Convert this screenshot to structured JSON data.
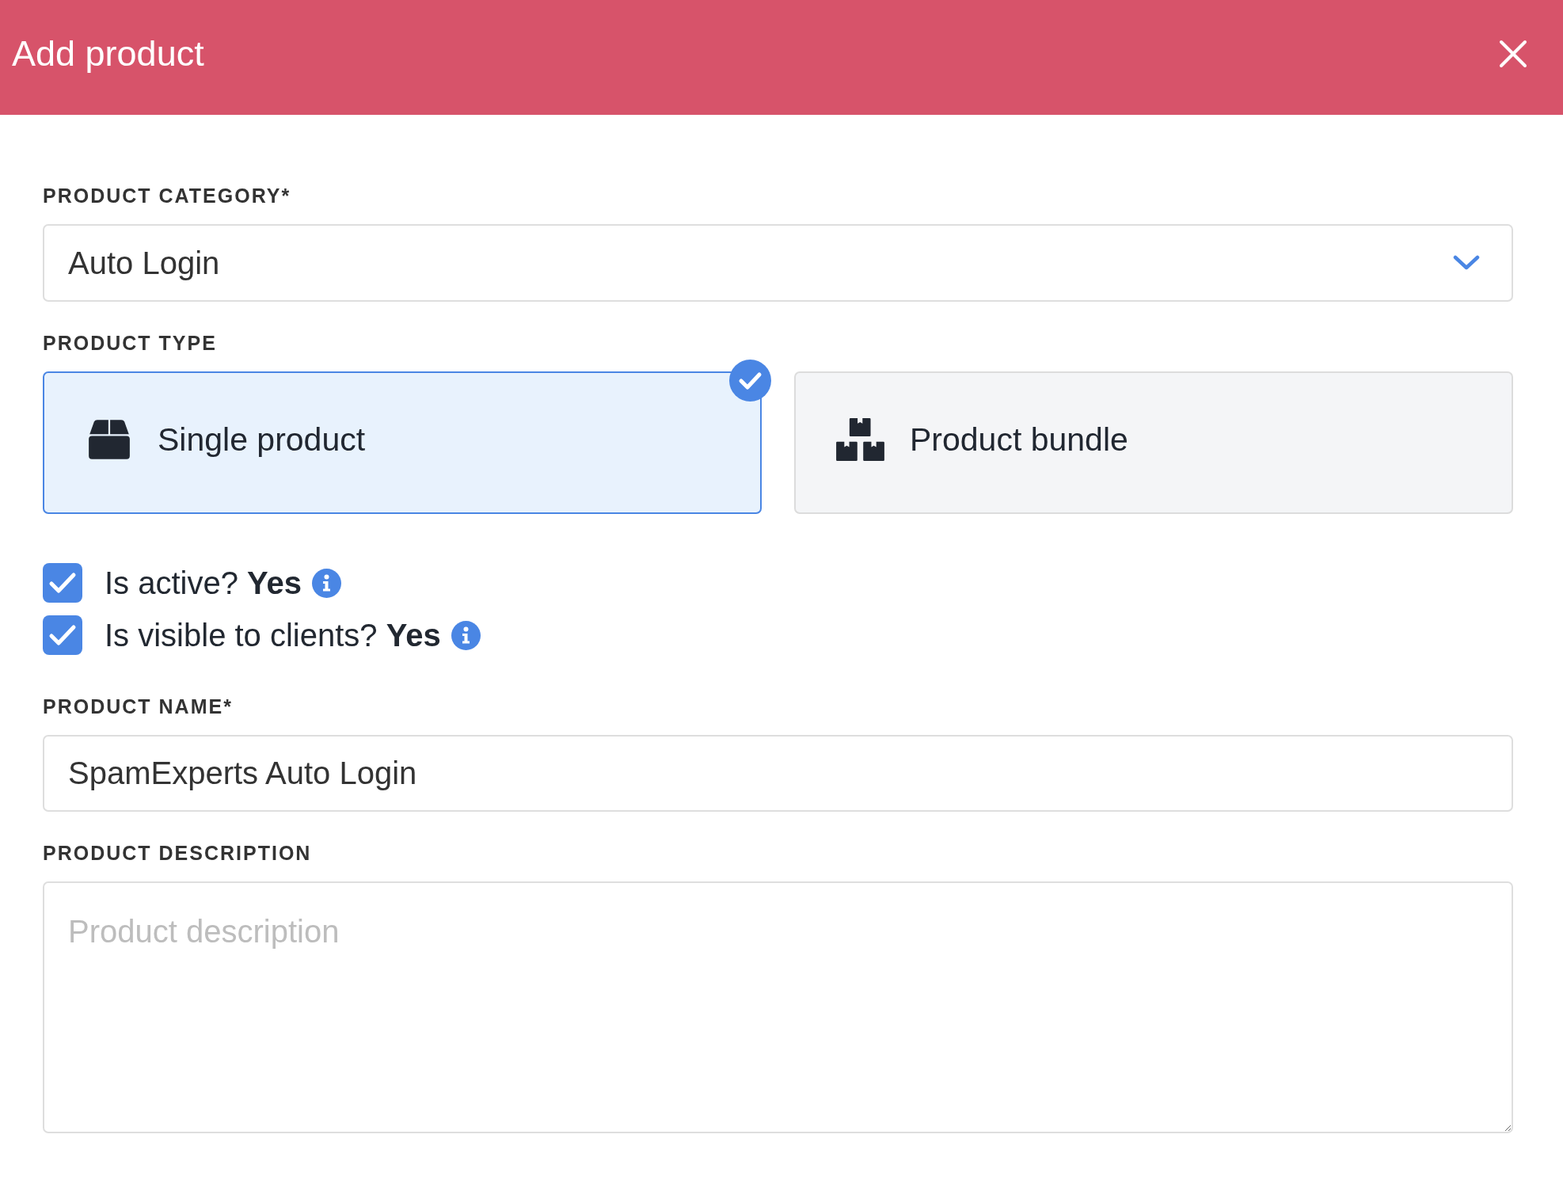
{
  "dialog": {
    "title": "Add product"
  },
  "category": {
    "label": "PRODUCT CATEGORY*",
    "value": "Auto Login"
  },
  "product_type": {
    "label": "PRODUCT TYPE",
    "options": [
      {
        "label": "Single product",
        "kind": "single",
        "selected": true
      },
      {
        "label": "Product bundle",
        "kind": "bundle",
        "selected": false
      }
    ]
  },
  "toggles": [
    {
      "label": "Is active? **Yes**",
      "checked": true
    },
    {
      "label": "Is visible to clients? **Yes**",
      "checked": true
    }
  ],
  "name": {
    "label": "PRODUCT NAME*",
    "value": "SpamExperts Auto Login"
  },
  "description": {
    "label": "PRODUCT DESCRIPTION",
    "placeholder": "Product description"
  }
}
